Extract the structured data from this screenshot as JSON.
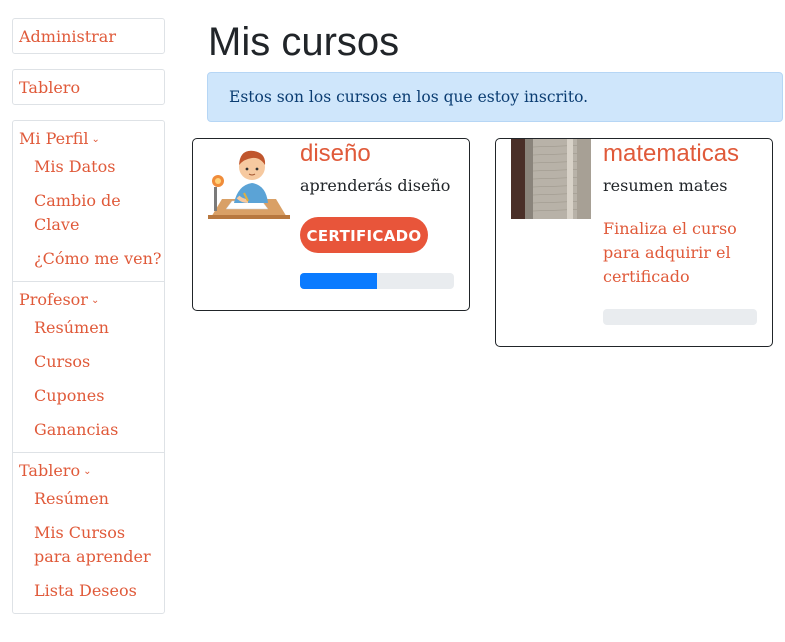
{
  "sidebar": {
    "administrar": "Administrar",
    "tablero_top": "Tablero",
    "mi_perfil": {
      "label": "Mi Perfil",
      "items": [
        "Mis Datos",
        "Cambio de Clave",
        "¿Cómo me ven?"
      ]
    },
    "profesor": {
      "label": "Profesor",
      "items": [
        "Resúmen",
        "Cursos",
        "Cupones",
        "Ganancias"
      ]
    },
    "tablero": {
      "label": "Tablero",
      "items": [
        "Resúmen",
        "Mis Cursos para aprender",
        "Lista Deseos"
      ]
    },
    "chevron_icon": "chevron-down-icon"
  },
  "main": {
    "title": "Mis cursos",
    "info": "Estos son los cursos en los que estoy inscrito.",
    "courses": [
      {
        "title": "diseño",
        "description": "aprenderás diseño",
        "button": "CERTIFICADO",
        "progress": 0.5,
        "thumbnail": "boy-drawing-illustration"
      },
      {
        "title": "matematicas",
        "description": "resumen mates",
        "finish_note": "Finaliza el curso para adquirir el certificado",
        "progress": 0,
        "thumbnail": "notebook-photo"
      }
    ]
  },
  "colors": {
    "accent": "#e05a3a",
    "button": "#e8553a",
    "progress": "#0a7bff",
    "info_bg": "#cfe6fb",
    "info_text": "#0b3d72"
  }
}
